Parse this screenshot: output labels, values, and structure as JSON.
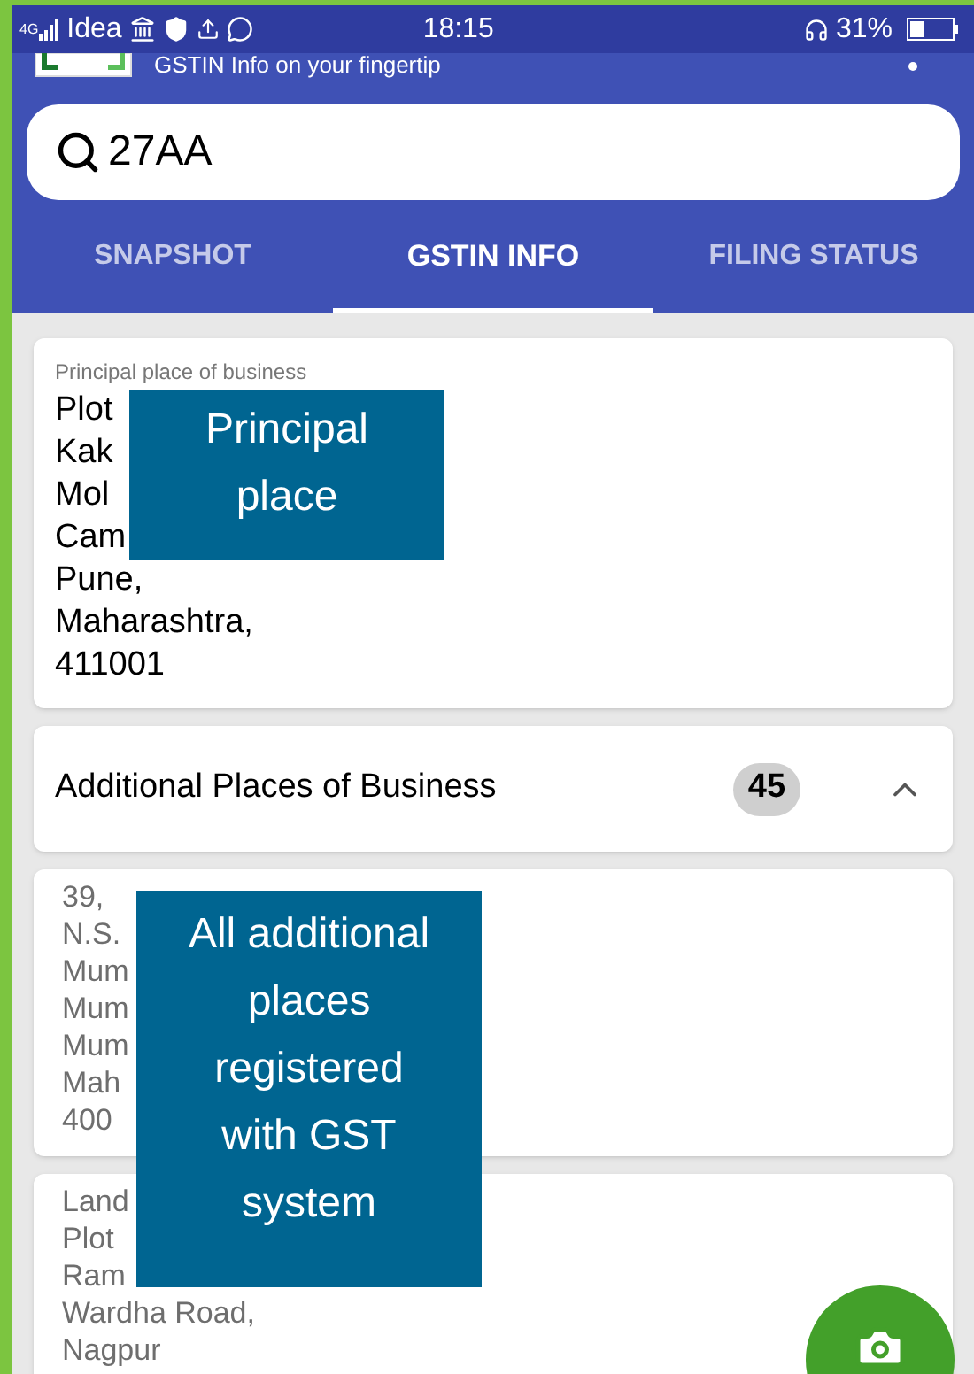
{
  "status_bar": {
    "network": "4G",
    "carrier": "Idea",
    "time": "18:15",
    "battery": "31%"
  },
  "app_bar": {
    "tagline": "GSTIN Info on your fingertip"
  },
  "search": {
    "value": "27AA"
  },
  "tabs": [
    {
      "label": "SNAPSHOT",
      "selected": false
    },
    {
      "label": "GSTIN INFO",
      "selected": true
    },
    {
      "label": "FILING STATUS",
      "selected": false
    }
  ],
  "principal": {
    "label": "Principal place of business",
    "lines": [
      "Plot",
      "Kak",
      "Mol",
      "Cam",
      "Pune,",
      "Maharashtra,",
      "411001"
    ]
  },
  "additional": {
    "title": "Additional Places of Business",
    "count": "45",
    "expanded": true
  },
  "places": [
    {
      "lines": [
        "39,",
        "N.S.",
        "Mum",
        "Mum",
        "Mum",
        "Mah",
        "400"
      ]
    },
    {
      "lines": [
        "Land",
        "Plot",
        "Ram",
        "Wardha Road,",
        "Nagpur"
      ]
    }
  ],
  "callouts": [
    {
      "text": "Principal place"
    },
    {
      "text": "All additional places registered with GST system"
    }
  ]
}
